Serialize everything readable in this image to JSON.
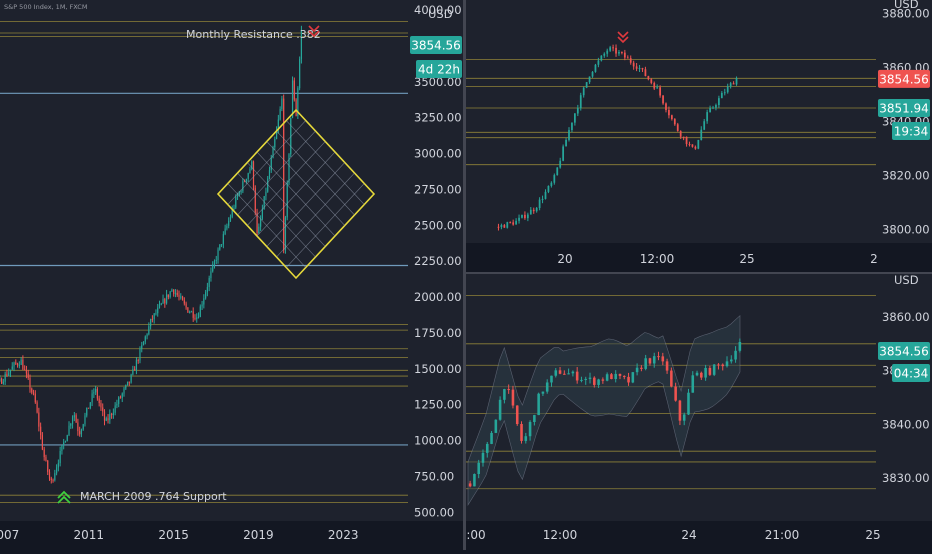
{
  "colors": {
    "background": "#1e222d",
    "axis_bg": "#131722",
    "grid": "#2a2e39",
    "up": "#26a69a",
    "down": "#ef5350",
    "fib_line": "#b5a23c",
    "blue_line": "#7fb1d6",
    "diamond": "#e6d93a",
    "text": "#d1d4dc",
    "price_tag": "#26a69a",
    "price_tag_red": "#ef5350",
    "arrow_up": "#3fd13f",
    "arrow_down": "#e0393e"
  },
  "chart_data": [
    {
      "type": "candlestick",
      "panel": "left",
      "title": "S&P 500 Index, 1M, FXCM",
      "currency": "USD",
      "x_ticks": [
        "2007",
        "2011",
        "2015",
        "2019",
        "2023"
      ],
      "y_ticks": [
        4000,
        3750,
        3500,
        3250,
        3000,
        2750,
        2500,
        2250,
        2000,
        1750,
        1500,
        1250,
        1000,
        750,
        500
      ],
      "ylim": [
        440,
        4070
      ],
      "last_price": "3854.56",
      "countdown": "4d 22h",
      "annotations": {
        "resistance": "Monthly Resistance .382",
        "support": "MARCH 2009 .764 Support"
      },
      "horizontal_levels": [
        3920,
        3840,
        3815,
        3420,
        2220,
        1810,
        1770,
        1640,
        1580,
        1490,
        1450,
        1380,
        970,
        620,
        570
      ],
      "price_path": [
        [
          "2004-01",
          1130
        ],
        [
          "2005-01",
          1180
        ],
        [
          "2006-01",
          1280
        ],
        [
          "2007-06",
          1520
        ],
        [
          "2007-10",
          1560
        ],
        [
          "2008-06",
          1280
        ],
        [
          "2008-11",
          900
        ],
        [
          "2009-03",
          700
        ],
        [
          "2010-04",
          1200
        ],
        [
          "2010-07",
          1050
        ],
        [
          "2011-04",
          1360
        ],
        [
          "2011-10",
          1120
        ],
        [
          "2012-12",
          1420
        ],
        [
          "2013-12",
          1840
        ],
        [
          "2014-12",
          2060
        ],
        [
          "2015-08",
          1920
        ],
        [
          "2016-02",
          1860
        ],
        [
          "2016-12",
          2250
        ],
        [
          "2017-12",
          2680
        ],
        [
          "2018-09",
          2930
        ],
        [
          "2018-12",
          2410
        ],
        [
          "2019-12",
          3230
        ],
        [
          "2020-02",
          3380
        ],
        [
          "2020-03",
          2300
        ],
        [
          "2020-08",
          3500
        ],
        [
          "2020-10",
          3270
        ],
        [
          "2021-01",
          3854
        ]
      ]
    },
    {
      "type": "candlestick",
      "panel": "top-right",
      "currency": "USD",
      "x_ticks": [
        "20",
        "12:00",
        "25",
        "2"
      ],
      "y_ticks": [
        3880,
        3860,
        3840,
        3820,
        3800
      ],
      "ylim": [
        3795,
        3885
      ],
      "last_price": "3854.56",
      "second_price": "3851.94",
      "countdown": "19:34",
      "horizontal_levels": [
        3863,
        3856,
        3853,
        3845,
        3836,
        3834,
        3824
      ],
      "price_path": [
        [
          0,
          3801
        ],
        [
          6,
          3803
        ],
        [
          12,
          3808
        ],
        [
          18,
          3818
        ],
        [
          24,
          3840
        ],
        [
          30,
          3858
        ],
        [
          36,
          3867
        ],
        [
          40,
          3865
        ],
        [
          46,
          3860
        ],
        [
          52,
          3852
        ],
        [
          58,
          3838
        ],
        [
          64,
          3829
        ],
        [
          68,
          3842
        ],
        [
          74,
          3851
        ],
        [
          78,
          3856
        ]
      ]
    },
    {
      "type": "candlestick",
      "panel": "bottom-right",
      "currency": "USD",
      "x_ticks": [
        ":00",
        "12:00",
        "24",
        "21:00",
        "25"
      ],
      "y_ticks": [
        3860,
        3850,
        3840,
        3830
      ],
      "ylim": [
        3822,
        3868
      ],
      "last_price": "3854.56",
      "countdown": "04:34",
      "horizontal_levels": [
        3864,
        3855,
        3851,
        3847,
        3842,
        3835,
        3833,
        3828
      ],
      "price_path": [
        [
          0,
          3829
        ],
        [
          6,
          3836
        ],
        [
          12,
          3848
        ],
        [
          18,
          3836
        ],
        [
          24,
          3846
        ],
        [
          30,
          3850
        ],
        [
          36,
          3849
        ],
        [
          42,
          3848
        ],
        [
          48,
          3849
        ],
        [
          54,
          3848
        ],
        [
          60,
          3852
        ],
        [
          66,
          3852
        ],
        [
          72,
          3840
        ],
        [
          76,
          3849
        ],
        [
          82,
          3850
        ],
        [
          88,
          3852
        ],
        [
          92,
          3855
        ]
      ]
    }
  ]
}
